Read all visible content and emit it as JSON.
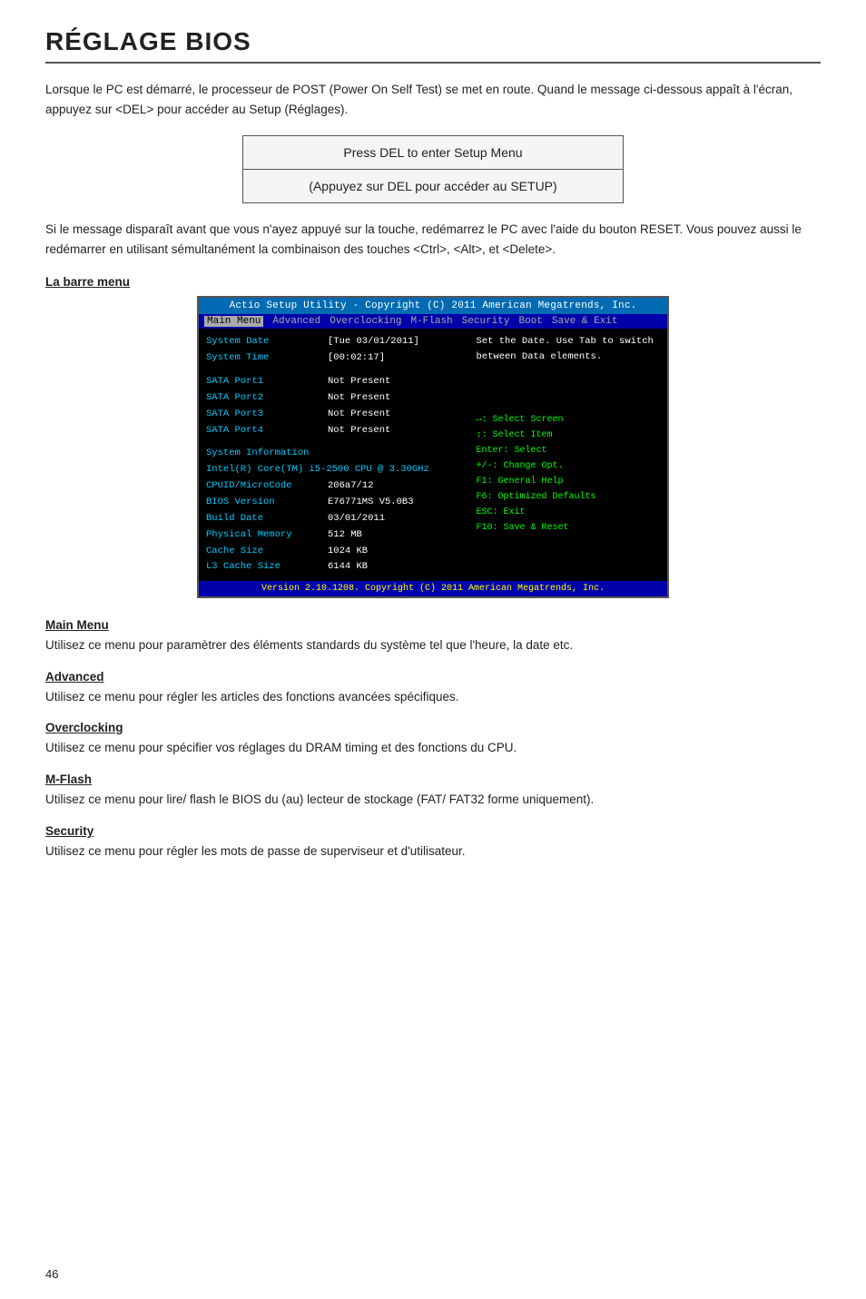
{
  "page": {
    "title": "RÉGLAGE BIOS",
    "page_number": "46"
  },
  "intro": {
    "paragraph1": "Lorsque le PC est démarré, le processeur de POST (Power On Self Test) se met en route. Quand le message ci-dessous appaît à l'écran, appuyez sur <DEL> pour accéder au Setup (Réglages).",
    "press_del_line1": "Press DEL to enter Setup Menu",
    "press_del_line2": "(Appuyez sur DEL pour accéder au SETUP)",
    "paragraph2": "Si le message disparaît avant que vous n'ayez appuyé sur la touche, redémarrez le PC avec l'aide du bouton RESET. Vous pouvez aussi le redémarrer en utilisant sémultanément la combinaison des touches <Ctrl>, <Alt>, et <Delete>."
  },
  "bios_screen": {
    "title_bar": "Actio Setup Utility - Copyright (C) 2011 American Megatrends, Inc.",
    "menu_items": [
      "Main Menu",
      "Advanced",
      "Overclocking",
      "M-Flash",
      "Security",
      "Boot",
      "Save & Exit"
    ],
    "active_menu": "Main Menu",
    "hint_text": "Set the Date. Use Tab to switch between Data elements.",
    "rows": [
      {
        "label": "System Date",
        "value": "[Tue 03/01/2011]"
      },
      {
        "label": "System Time",
        "value": "[00:02:17]"
      },
      {
        "label": "",
        "value": ""
      },
      {
        "label": "SATA Port1",
        "value": "Not Present"
      },
      {
        "label": "SATA Port2",
        "value": "Not Present"
      },
      {
        "label": "SATA Port3",
        "value": "Not Present"
      },
      {
        "label": "SATA Port4",
        "value": "Not Present"
      },
      {
        "label": "",
        "value": ""
      },
      {
        "label": "System Information",
        "value": ""
      },
      {
        "label": "Intel(R) Core(TM) i5-2500 CPU @ 3.30GHz",
        "value": ""
      },
      {
        "label": "CPUID/MicroCode",
        "value": "206a7/12"
      },
      {
        "label": "BIOS Version",
        "value": "E76771MS V5.0B3"
      },
      {
        "label": "Build Date",
        "value": "03/01/2011"
      },
      {
        "label": "Physical Memory",
        "value": "512 MB"
      },
      {
        "label": "Cache Size",
        "value": "1024 KB"
      },
      {
        "label": "L3 Cache Size",
        "value": "6144 KB"
      }
    ],
    "shortcuts": [
      "↔: Select Screen",
      "↕: Select Item",
      "Enter: Select",
      "+/-: Change Opt.",
      "F1: General Help",
      "F6: Optimized Defaults",
      "ESC: Exit",
      "F10: Save & Reset"
    ],
    "footer": "Version 2.10.1208. Copyright (C) 2011 American Megatrends, Inc."
  },
  "menu_bar_section": {
    "heading": "La barre menu"
  },
  "sections": [
    {
      "id": "main-menu",
      "title": "Main Menu",
      "text": "Utilisez ce menu pour paramètrer des éléments standards du système tel que l'heure, la date etc."
    },
    {
      "id": "advanced",
      "title": "Advanced",
      "text": "Utilisez ce menu pour régler les articles des fonctions avancées spécifiques."
    },
    {
      "id": "overclocking",
      "title": "Overclocking",
      "text": "Utilisez ce menu pour spécifier vos réglages du DRAM timing et des fonctions du CPU."
    },
    {
      "id": "m-flash",
      "title": "M-Flash",
      "text": "Utilisez ce menu pour  lire/ flash le BIOS du (au) lecteur de stockage (FAT/ FAT32 forme uniquement)."
    },
    {
      "id": "security",
      "title": "Security",
      "text": "Utilisez ce menu pour régler les mots de passe de superviseur et d'utilisateur."
    }
  ]
}
